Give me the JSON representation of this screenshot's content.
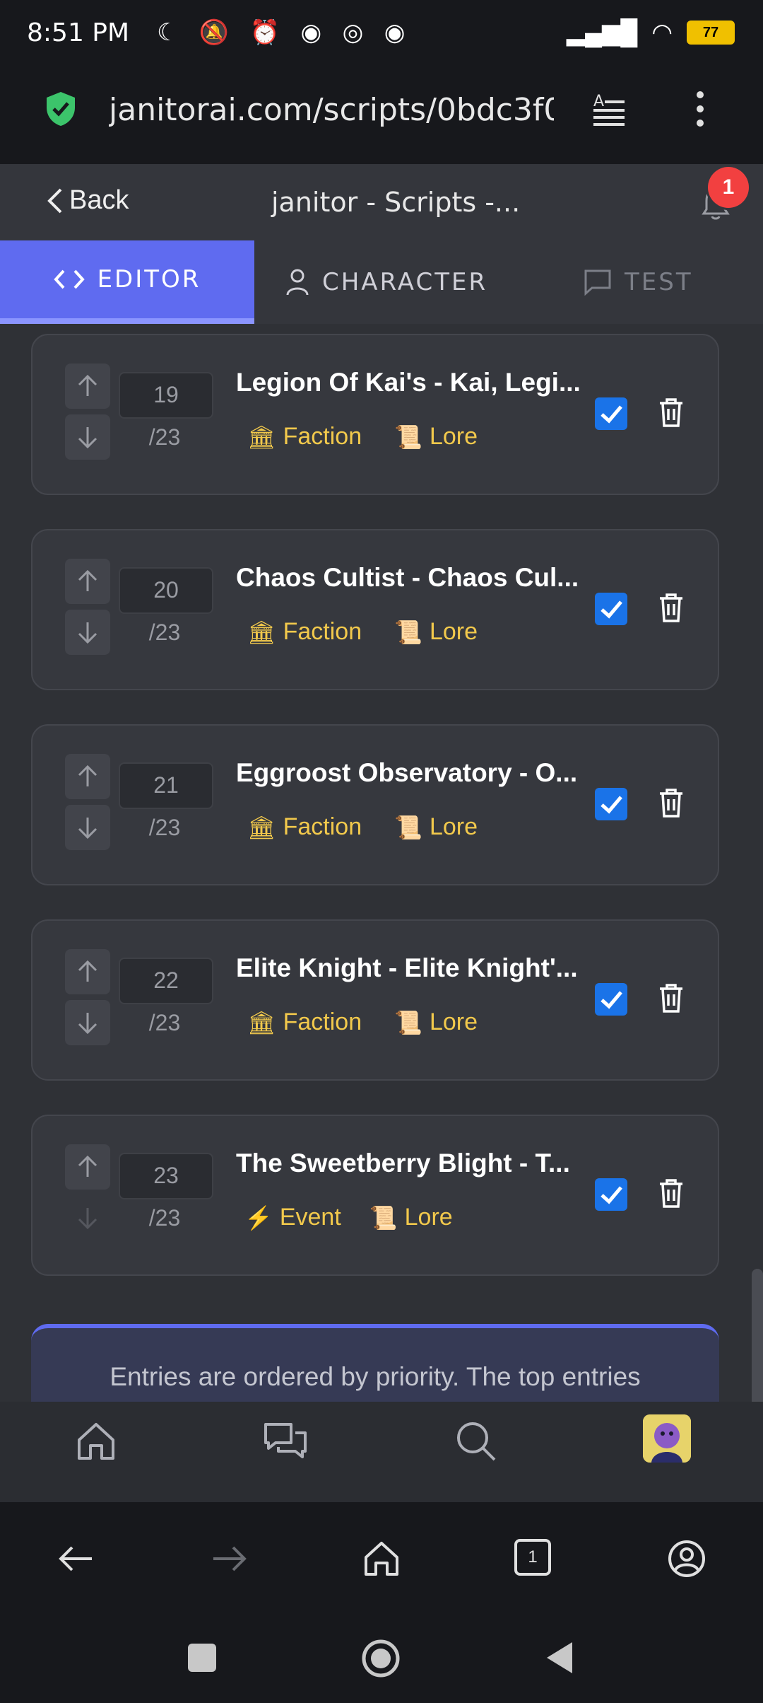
{
  "status_bar": {
    "time": "8:51 PM",
    "battery": "77"
  },
  "url_bar": {
    "url": "janitorai.com/scripts/0bdc3f0"
  },
  "header": {
    "back_label": "Back",
    "title": "janitor - Scripts -...",
    "notification_count": "1"
  },
  "tabs": [
    {
      "label": "EDITOR",
      "active": true
    },
    {
      "label": "CHARACTER",
      "active": false
    },
    {
      "label": "TEST",
      "active": false
    }
  ],
  "entries": [
    {
      "priority": "19",
      "total": "/23",
      "title": "Legion Of Kai's - Kai, Legi...",
      "tag1": "Faction",
      "tag1_icon": "🏛",
      "tag2": "Lore",
      "tag2_icon": "📜",
      "enabled": true
    },
    {
      "priority": "20",
      "total": "/23",
      "title": "Chaos Cultist - Chaos Cul...",
      "tag1": "Faction",
      "tag1_icon": "🏛",
      "tag2": "Lore",
      "tag2_icon": "📜",
      "enabled": true
    },
    {
      "priority": "21",
      "total": "/23",
      "title": "Eggroost Observatory - O...",
      "tag1": "Faction",
      "tag1_icon": "🏛",
      "tag2": "Lore",
      "tag2_icon": "📜",
      "enabled": true
    },
    {
      "priority": "22",
      "total": "/23",
      "title": "Elite Knight - Elite Knight'...",
      "tag1": "Faction",
      "tag1_icon": "🏛",
      "tag2": "Lore",
      "tag2_icon": "📜",
      "enabled": true
    },
    {
      "priority": "23",
      "total": "/23",
      "title": "The Sweetberry Blight - T...",
      "tag1": "Event",
      "tag1_icon": "⚡",
      "tag2": "Lore",
      "tag2_icon": "📜",
      "enabled": true
    }
  ],
  "info_text": "Entries are ordered by priority. The top entries",
  "browser": {
    "tab_count": "1"
  },
  "colors": {
    "accent": "#5f6bf0",
    "tag_text": "#f2c94c",
    "checkbox": "#1a73e8",
    "badge": "#f24040"
  }
}
